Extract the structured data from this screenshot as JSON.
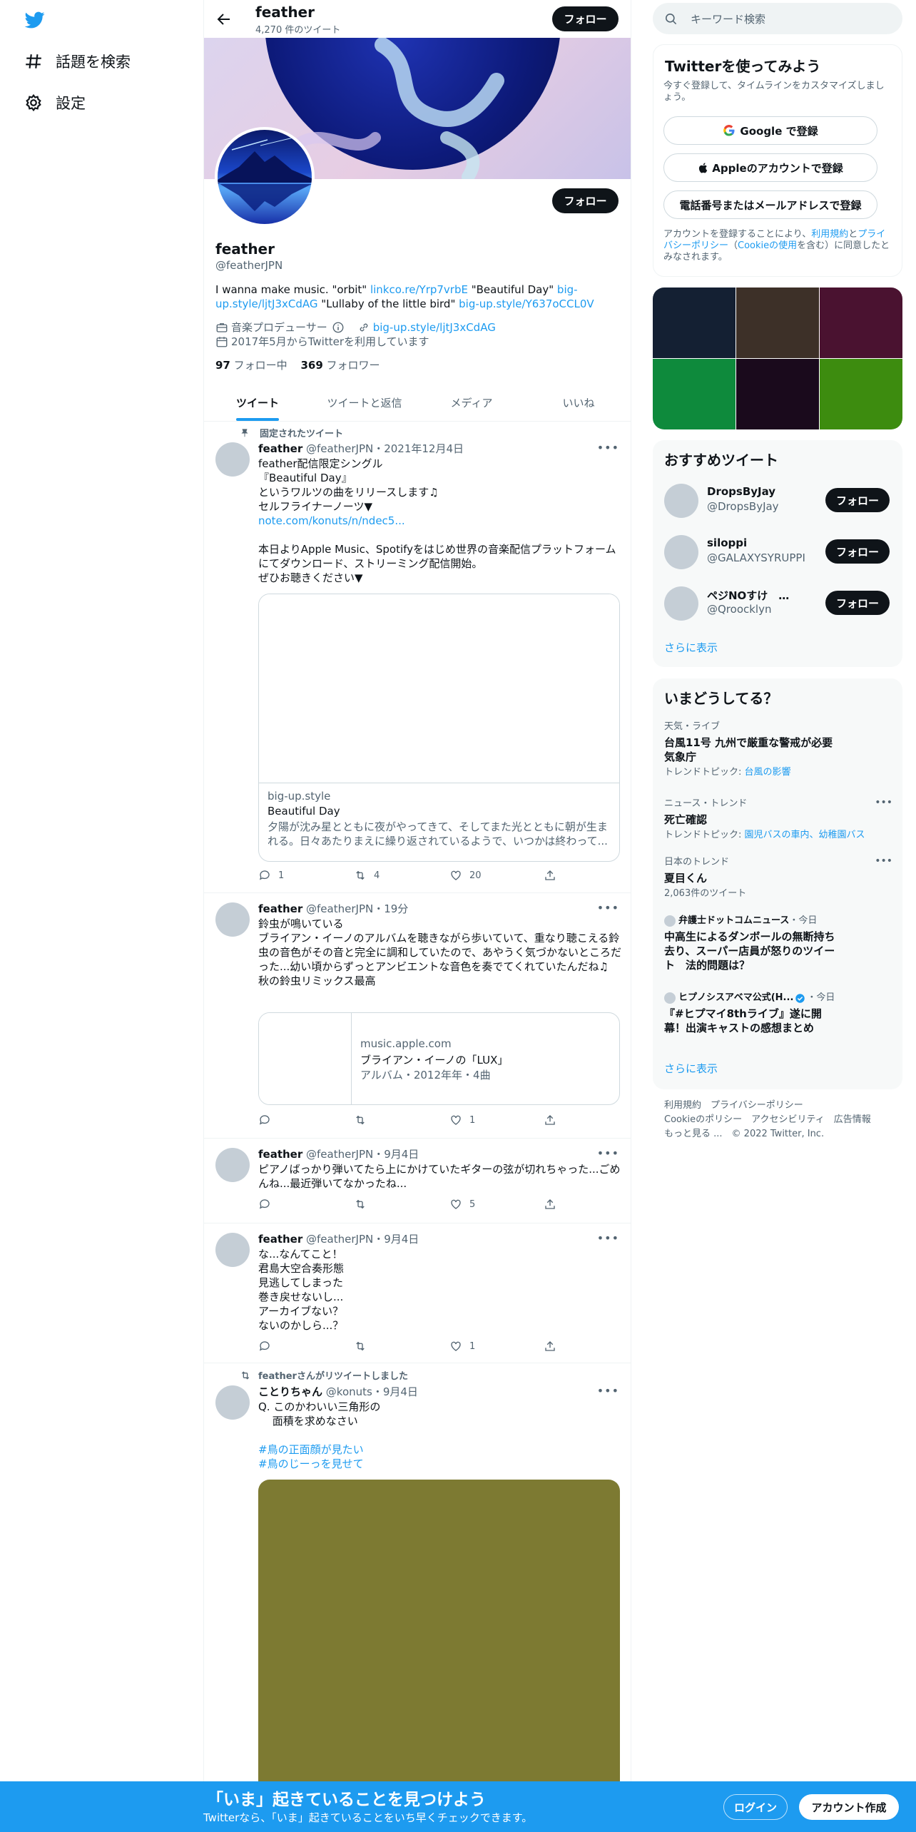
{
  "nav": {
    "logo_icon": "twitter-bird-icon",
    "explore_label": "話題を検索",
    "settings_label": "設定"
  },
  "topbar": {
    "name": "feather",
    "tweet_count": "4,270 件のツイート",
    "follow_label": "フォロー"
  },
  "profile": {
    "name": "feather",
    "handle": "@featherJPN",
    "follow_label": "フォロー",
    "bio": {
      "p1": "I wanna make music. \"orbit\" ",
      "link1": "linkco.re/Yrp7vrbE",
      "p2": " \"Beautiful Day\" ",
      "link2": "big-up.style/ljtJ3xCdAG",
      "p3": " \"Lullaby of the little bird\" ",
      "link3": "big-up.style/Y637oCCL0V"
    },
    "category": "音楽プロデューサー",
    "website": "big-up.style/ljtJ3xCdAG",
    "joined": "2017年5月からTwitterを利用しています",
    "following_count": "97",
    "following_label": "フォロー中",
    "followers_count": "369",
    "followers_label": "フォロワー"
  },
  "tabs": [
    "ツイート",
    "ツイートと返信",
    "メディア",
    "いいね"
  ],
  "tweets": [
    {
      "pinned_label": "固定されたツイート",
      "name": "feather",
      "meta": "@featherJPN・2021年12月4日",
      "text_a": "feather配信限定シングル\n『Beautiful Day』\nというワルツの曲をリリースします♫\nセルフライナーノーツ▼\n",
      "link": "note.com/konuts/n/ndec5...",
      "text_b": "\n\n本日よりApple Music、Spotifyをはじめ世界の音楽配信プラットフォームにてダウンロード、ストリーミング配信開始。\nぜひお聴きください▼",
      "card_domain": "big-up.style",
      "card_title": "Beautiful Day",
      "card_desc": "夕陽が沈み星とともに夜がやってきて、そしてまた光とともに朝が生まれる。日々あたりまえに繰り返されているようで、いつかは終わって...",
      "replies": "1",
      "retweets": "4",
      "likes": "20"
    },
    {
      "name": "feather",
      "meta": "@featherJPN・19分",
      "text": "鈴虫が鳴いている\nブライアン・イーノのアルバムを聴きながら歩いていて、重なり聴こえる鈴虫の音色がその音と完全に調和していたので、あやうく気づかないところだった...幼い頃からずっとアンビエントな音色を奏でてくれていたんだね♫\n秋の鈴虫リミックス最高",
      "card_domain": "music.apple.com",
      "card_title": "ブライアン・イーノの「LUX」",
      "card_desc": "アルバム・2012年年・4曲",
      "replies": "",
      "retweets": "",
      "likes": "1"
    },
    {
      "name": "feather",
      "meta": "@featherJPN・9月4日",
      "text": "ピアノばっかり弾いてたら上にかけていたギターの弦が切れちゃった...ごめんね...最近弾いてなかったね...",
      "replies": "",
      "retweets": "",
      "likes": "5"
    },
    {
      "name": "feather",
      "meta": "@featherJPN・9月4日",
      "text": "な...なんてこと！\n君島大空合奏形態\n見逃してしまった\n巻き戻せないし...\nアーカイブない？\nないのかしら...？",
      "replies": "",
      "retweets": "",
      "likes": "1"
    },
    {
      "retweet_label": "featherさんがリツイートしました",
      "name": "ことりちゃん",
      "meta": "@konuts・9月4日",
      "text": "Q. このかわいい三角形の\n　 面積を求めなさい",
      "hashtag1": "#鳥の正面顔が見たい",
      "hashtag2": "#鳥のじーっを見せて"
    }
  ],
  "right": {
    "search_placeholder": "キーワード検索",
    "signup_title": "Twitterを使ってみよう",
    "signup_sub": "今すぐ登録して、タイムラインをカスタマイズしましょう。",
    "btn_google": "Google で登録",
    "btn_apple": "Appleのアカウントで登録",
    "btn_phone": "電話番号またはメールアドレスで登録",
    "terms": {
      "p1": "アカウントを登録することにより、",
      "l1": "利用規約",
      "p2": "と",
      "l2": "プライバシーポリシー",
      "p3": "（",
      "l3": "Cookieの使用",
      "p4": "を含む）に同意したとみなされます。"
    },
    "media_colors": [
      "#142033",
      "#3d3028",
      "#4a1230",
      "#0e8a3c",
      "#1a0a1c",
      "#3d8c0f"
    ],
    "rec_title": "おすすめツイート",
    "recs": [
      {
        "name": "DropsByJay",
        "handle": "@DropsByJay"
      },
      {
        "name": "siloppi",
        "handle": "@GALAXYSYRUPPI"
      },
      {
        "name": "ペジNOすけ　…",
        "handle": "@Qroocklyn"
      }
    ],
    "follow_label": "フォロー",
    "show_more": "さらに表示",
    "trends_title": "いまどうしてる？",
    "trends": [
      {
        "cat": "天気・ライブ",
        "title": "台風11号 九州で厳重な警戒が必要 気象庁",
        "topic_label": "トレンドトピック: ",
        "topic": "台風の影響"
      },
      {
        "cat": "ニュース・トレンド",
        "title": "死亡確認",
        "topic_label": "トレンドトピック: ",
        "topic": "園児バスの車内、幼稚園バス"
      },
      {
        "cat": "日本のトレンド",
        "title": "夏目くん",
        "count": "2,063件のツイート"
      },
      {
        "source": "弁護士ドットコムニュース",
        "time": "・今日",
        "title": "中高生によるダンボールの無断持ち去り、スーパー店員が怒りのツイート　法的問題は？"
      },
      {
        "source": "ヒプノシスアベマ公式(H...",
        "time": "・今日",
        "title": "『#ヒプマイ8thライブ』遂に開幕！出演キャストの感想まとめ"
      }
    ],
    "footer": {
      "tos": "利用規約",
      "privacy": "プライバシーポリシー",
      "cookie": "Cookieのポリシー",
      "access": "アクセシビリティ",
      "ads": "広告情報",
      "more": "もっと見る ...",
      "copy": "© 2022 Twitter, Inc."
    }
  },
  "bottom": {
    "title": "「いま」起きていることを見つけよう",
    "sub": "Twitterなら、「いま」起きていることをいち早くチェックできます。",
    "login": "ログイン",
    "signup": "アカウント作成"
  }
}
